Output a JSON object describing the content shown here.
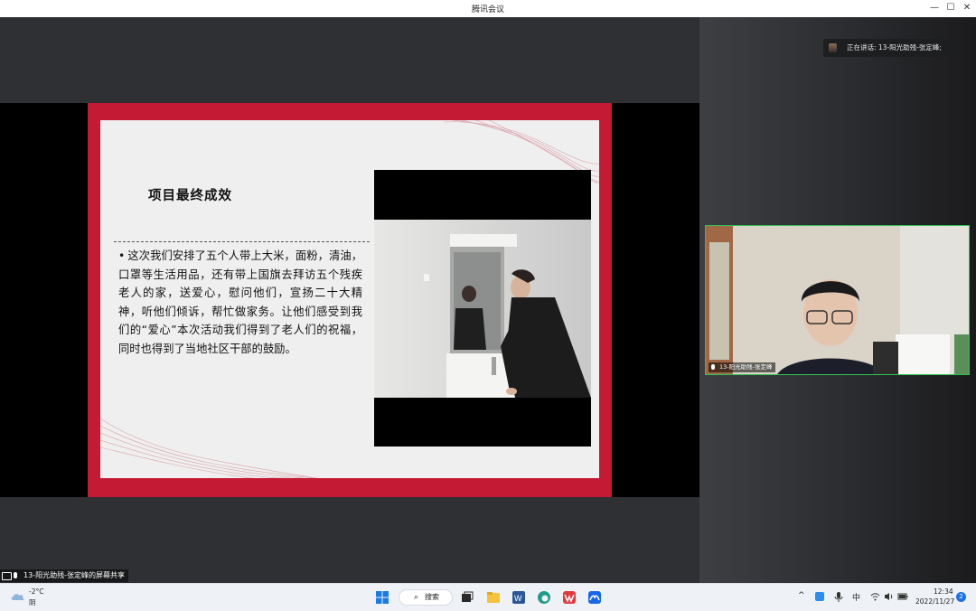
{
  "window": {
    "title": "腾讯会议",
    "controls": {
      "minimize": "—",
      "maximize": "☐",
      "close": "✕"
    }
  },
  "slide": {
    "title": "项目最终成效",
    "bullet": "•",
    "body": "这次我们安排了五个人带上大米，面粉，清油，口罩等生活用品，还有带上国旗去拜访五个残疾老人的家，送爱心，慰问他们，宣扬二十大精神，听他们倾诉，帮忙做家务。让他们感受到我们的“爱心”本次活动我们得到了老人们的祝福，同时也得到了当地社区干部的鼓励。"
  },
  "speaking": {
    "text": "正在讲话: 13-阳光助残-张定峰;"
  },
  "participant": {
    "name": "13-阳光助残-张定峰"
  },
  "share_indicator": {
    "text": "13-阳光助残-张定峰的屏幕共享"
  },
  "taskbar": {
    "weather": {
      "temp": "-2°C",
      "desc": "阴"
    },
    "search_label": "搜索",
    "search_icon": "⌕",
    "tray": {
      "chevron": "^",
      "ime": "中"
    },
    "time": "12:34",
    "date": "2022/11/27",
    "notifications": "2"
  },
  "colors": {
    "slide_frame": "#c41a34",
    "active_speaker_border": "#2fc454",
    "windows_blue": "#1a73e8"
  },
  "icons": [
    "cloud-icon",
    "windows-start-icon",
    "search-icon",
    "task-view-icon",
    "file-explorer-icon",
    "word-icon",
    "edge-icon",
    "wps-icon",
    "tencent-meeting-icon",
    "wifi-icon",
    "volume-icon",
    "battery-icon",
    "mic-icon",
    "screen-share-icon"
  ]
}
